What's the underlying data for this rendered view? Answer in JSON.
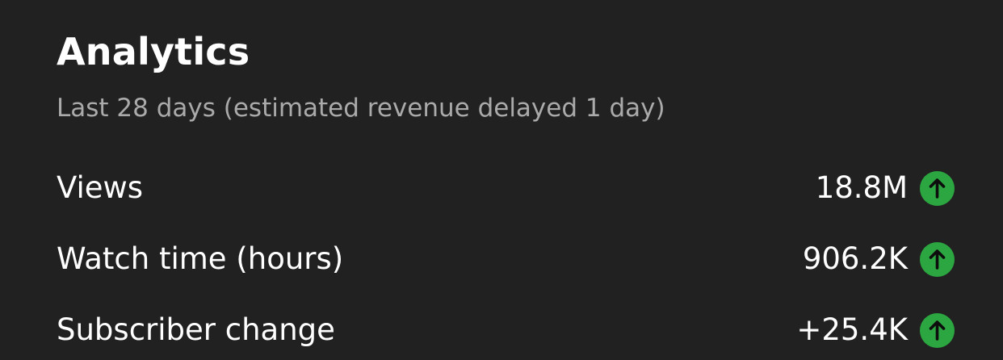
{
  "header": {
    "title": "Analytics",
    "subtitle": "Last 28 days (estimated revenue delayed 1 day)"
  },
  "metrics": [
    {
      "label": "Views",
      "value": "18.8M",
      "trend": "up",
      "trend_icon": "arrow-up-icon"
    },
    {
      "label": "Watch time (hours)",
      "value": "906.2K",
      "trend": "up",
      "trend_icon": "arrow-up-icon"
    },
    {
      "label": "Subscriber change",
      "value": "+25.4K",
      "trend": "up",
      "trend_icon": "arrow-up-icon"
    }
  ],
  "colors": {
    "background": "#212121",
    "text_primary": "#ffffff",
    "text_secondary": "#aaaaaa",
    "trend_up": "#2ba640"
  }
}
